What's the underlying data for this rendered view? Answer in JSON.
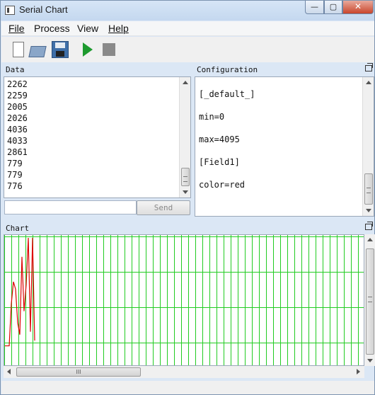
{
  "window": {
    "title": "Serial Chart",
    "minimize_glyph": "—",
    "maximize_glyph": "▢",
    "close_glyph": "✕"
  },
  "menu": {
    "items": [
      {
        "label": "File",
        "accel": "F"
      },
      {
        "label": "Process",
        "accel": ""
      },
      {
        "label": "View",
        "accel": ""
      },
      {
        "label": "Help",
        "accel": "H"
      }
    ]
  },
  "toolbar": {
    "icons": [
      "new-document-icon",
      "open-folder-icon",
      "save-disk-icon",
      "run-play-icon",
      "stop-square-icon"
    ]
  },
  "data_panel": {
    "title": "Data",
    "lines": [
      "2262",
      "2259",
      "2005",
      "2026",
      "4036",
      "4033",
      "2861",
      "779",
      "779",
      "776"
    ],
    "send_input_value": "",
    "send_label": "Send"
  },
  "config_panel": {
    "title": "Configuration",
    "lines": [
      "[_default_]",
      "min=0",
      "max=4095",
      "[Field1]",
      "color=red"
    ]
  },
  "chart_panel": {
    "title": "Chart",
    "grid_color": "#22cc22",
    "series_color": "#dd0000",
    "hscroll_grip": "III"
  },
  "chart_data": {
    "type": "line",
    "ylim": [
      0,
      4095
    ],
    "grid": true,
    "series": [
      {
        "color": "red",
        "values": [
          420,
          420,
          420,
          1850,
          2600,
          2350,
          1200,
          800,
          3450,
          1600,
          2500,
          4095,
          900,
          4095,
          600
        ]
      }
    ]
  }
}
